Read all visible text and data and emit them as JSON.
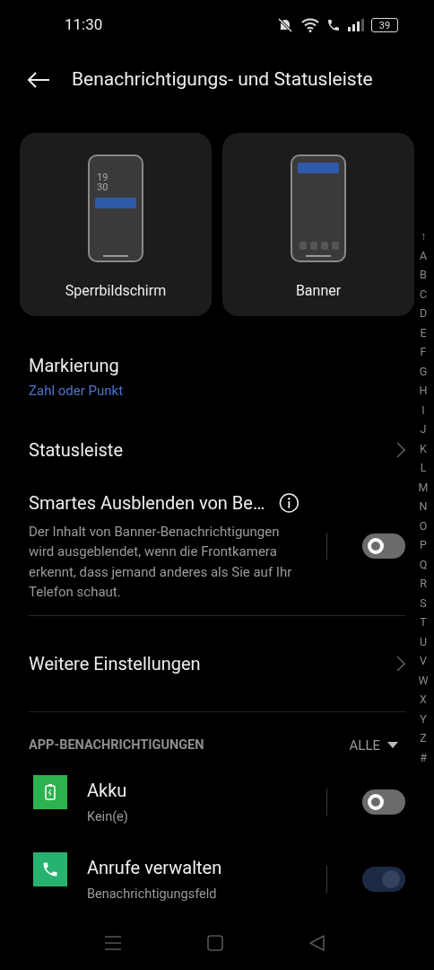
{
  "status_bar": {
    "time": "11:30",
    "battery": "39"
  },
  "header": {
    "title": "Benachrichtigungs- und Statusleiste"
  },
  "styles": [
    {
      "kind": "lockscreen",
      "label": "Sperrbildschirm",
      "clock": "19\n30"
    },
    {
      "kind": "banner",
      "label": "Banner"
    }
  ],
  "settings": [
    {
      "kind": "value",
      "title": "Markierung",
      "value": "Zahl oder Punkt"
    },
    {
      "kind": "link",
      "title": "Statusleiste"
    },
    {
      "kind": "toggle",
      "title": "Smartes Ausblenden von Be…",
      "description": "Der Inhalt von Banner-Benachrichtigungen wird ausgeblendet, wenn die Frontkamera erkennt, dass jemand anderes als Sie auf Ihr Telefon schaut.",
      "on": false
    },
    {
      "kind": "link",
      "title": "Weitere Einstellungen"
    }
  ],
  "app_section": {
    "title": "APP-BENACHRICHTIGUNGEN",
    "filter": "ALLE"
  },
  "apps": [
    {
      "kind": "battery",
      "name": "Akku",
      "detail": "Kein(e)",
      "on": false
    },
    {
      "kind": "phone",
      "name": "Anrufe verwalten",
      "detail": "Benachrichtigungsfeld",
      "on": true
    }
  ],
  "index": [
    "↑",
    "A",
    "B",
    "C",
    "D",
    "E",
    "F",
    "G",
    "H",
    "I",
    "J",
    "K",
    "L",
    "M",
    "N",
    "O",
    "P",
    "Q",
    "R",
    "S",
    "T",
    "U",
    "V",
    "W",
    "X",
    "Y",
    "Z",
    "#"
  ]
}
